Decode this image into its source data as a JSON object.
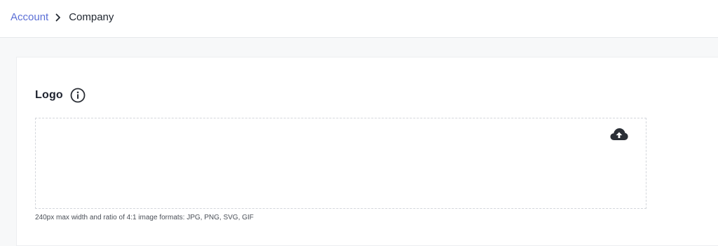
{
  "breadcrumb": {
    "parent_label": "Account",
    "current_label": "Company",
    "separator_icon": "chevron-right-icon"
  },
  "logo_section": {
    "title": "Logo",
    "info_icon": "info-icon",
    "upload_icon": "cloud-upload-icon",
    "hint": "240px max width and ratio of 4:1 image formats: JPG, PNG, SVG, GIF"
  },
  "colors": {
    "link": "#5b6fd6",
    "text": "#222831",
    "icon": "#2b2f36",
    "page_background": "#f7f8f9"
  }
}
